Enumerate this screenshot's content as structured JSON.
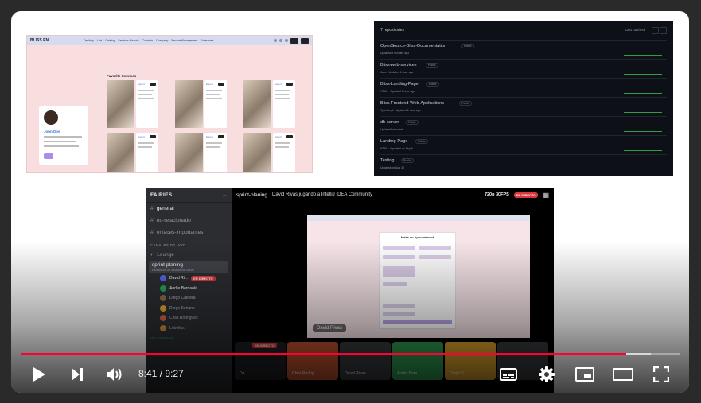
{
  "player": {
    "current_time": "8:41",
    "separator": " / ",
    "duration": "9:27",
    "progress": 0.918,
    "buffered": 0.955,
    "progress_color": "#ff0033"
  },
  "controls": [
    "play-icon",
    "next-icon",
    "volume-icon",
    "subtitles-icon",
    "settings-icon",
    "miniplayer-icon",
    "theater-icon",
    "fullscreen-icon"
  ],
  "site": {
    "logo": "BLISS EN",
    "nav": [
      "Desktop",
      "Link",
      "Catalog",
      "Services Historic",
      "Contacts",
      "Company",
      "Service Management",
      "Enterprise"
    ],
    "profile_name": "John Doe",
    "favorites_title": "Favorite Services",
    "service_tag": "Expert"
  },
  "github": {
    "count": "7 repositories",
    "sort": "Last pushed",
    "repos": [
      {
        "name": "OpenSource-Bliss-Documentation",
        "visibility": "Public",
        "meta": "Updated 5 minutes ago"
      },
      {
        "name": "Bliss-web-services",
        "visibility": "Public",
        "meta": "Java · Updated 1 hour ago"
      },
      {
        "name": "Bliss-Landing-Page",
        "visibility": "Public",
        "meta": "HTML · Updated 1 hour ago"
      },
      {
        "name": "Bliss-Frontend-Web-Applications",
        "visibility": "Public",
        "meta": "TypeScript · Updated 1 hour ago"
      },
      {
        "name": "db-server",
        "visibility": "Public",
        "meta": "Updated last week"
      },
      {
        "name": "Landing-Page",
        "visibility": "Public",
        "meta": "HTML · Updated on Sep 9"
      },
      {
        "name": "Testing",
        "visibility": "Public",
        "meta": "Updated on Aug 30"
      }
    ]
  },
  "discord": {
    "server": "FAIRIES",
    "channels": [
      "general",
      "no-relacionado",
      "enlaces-importantes"
    ],
    "voice_category": "CANALES DE VOZ",
    "lounge": "Lounge",
    "voice_channel": "sprint-planing",
    "voice_status": "Establece un estado de canal",
    "users": [
      "David Ri...",
      "Andre Bernaola",
      "Diego Cabrera",
      "Diego Soriano",
      "Chila Rodrigues",
      "Lobellus"
    ],
    "live_label": "EN DIRECTO",
    "header_channel": "sprint-planing",
    "header_stream": "David Rivas jugando a IntelliJ IDEA Community",
    "quality": "720p 30FPS",
    "stream_name": "David Rivas",
    "form_title": "Make an Appointment",
    "tiles": [
      "Da...",
      "Chila Rodrig...",
      "David Rivas",
      "Andre Bern...",
      "Diego S..."
    ],
    "connected": "Voz conectada"
  }
}
